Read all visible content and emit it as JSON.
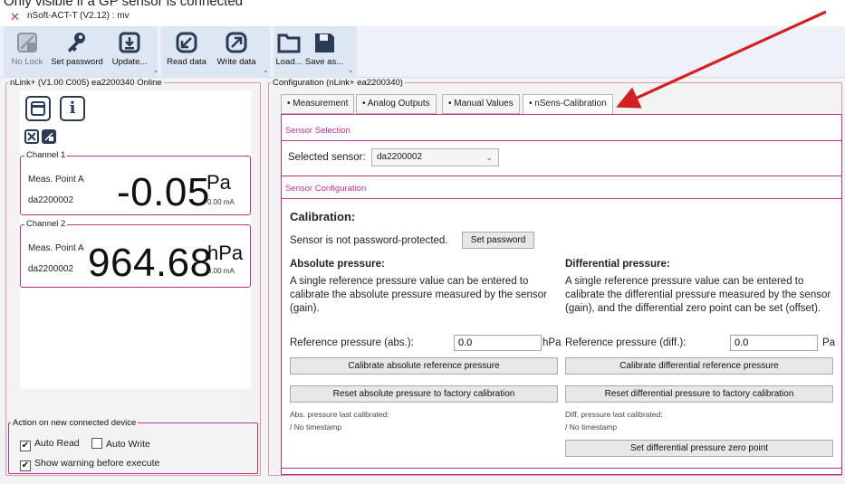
{
  "caption": "Only visible if a GP sensor is connected",
  "window": {
    "title": "nSoft-ACT-T (V2.12) : mv"
  },
  "toolbar": {
    "no_lock": "No Lock",
    "set_password": "Set password",
    "update": "Update...",
    "read_data": "Read data",
    "write_data": "Write data",
    "load": "Load...",
    "save_as": "Save as...",
    "sep": "⌄"
  },
  "left_panel": {
    "group_title": "nLink+ (V1.00 C005) ea2200340 Online",
    "channels": [
      {
        "title": "Channel 1",
        "meas_point": "Meas. Point A",
        "sensor": "da2200002",
        "value": "-0.05",
        "unit": "Pa",
        "current": "0.00 mA"
      },
      {
        "title": "Channel 2",
        "meas_point": "Meas. Point A",
        "sensor": "da2200002",
        "value": "964.68",
        "unit": "hPa",
        "current": "0.00 mA"
      }
    ],
    "action": {
      "title": "Action on new connected device",
      "auto_read": "Auto Read",
      "auto_read_checked": true,
      "auto_write": "Auto Write",
      "auto_write_checked": false,
      "show_warning": "Show warning before execute",
      "show_warning_checked": true
    }
  },
  "config": {
    "group_title": "Configuration (nLink+ ea2200340)",
    "tabs": [
      "• Measurement",
      "• Analog Outputs",
      "• Manual Values",
      "• nSens-Calibration"
    ],
    "active_tab": "• nSens-Calibration",
    "sensor_selection": {
      "heading": "Sensor Selection",
      "label": "Selected sensor:",
      "value": "da2200002"
    },
    "sensor_configuration": {
      "heading": "Sensor Configuration",
      "calibration_title": "Calibration:",
      "password_status": "Sensor is not password-protected.",
      "set_password_button": "Set password",
      "absolute": {
        "title": "Absolute pressure:",
        "description": "A single reference pressure value can be entered to calibrate the absolute pressure measured by the sensor (gain).",
        "ref_label": "Reference pressure (abs.):",
        "ref_value": "0.0",
        "ref_unit": "hPa",
        "calibrate_button": "Calibrate absolute reference pressure",
        "reset_button": "Reset absolute pressure to factory calibration",
        "last_calibrated_label": "Abs. pressure last calibrated:",
        "last_calibrated_value": "/ No timestamp"
      },
      "differential": {
        "title": "Differential pressure:",
        "description": "A single reference pressure value can be entered to calibrate the differential pressure measured by the sensor (gain), and the differential zero point can be set (offset).",
        "ref_label": "Reference pressure (diff.):",
        "ref_value": "0.0",
        "ref_unit": "Pa",
        "calibrate_button": "Calibrate differential reference pressure",
        "reset_button": "Reset differential pressure to factory calibration",
        "last_calibrated_label": "Diff. pressure last calibrated:",
        "last_calibrated_value": "/ No timestamp",
        "zero_button": "Set differential pressure zero point"
      }
    }
  },
  "colors": {
    "accent": "#c0308f",
    "arrow": "#d32020",
    "icon": "#2b3a55"
  }
}
